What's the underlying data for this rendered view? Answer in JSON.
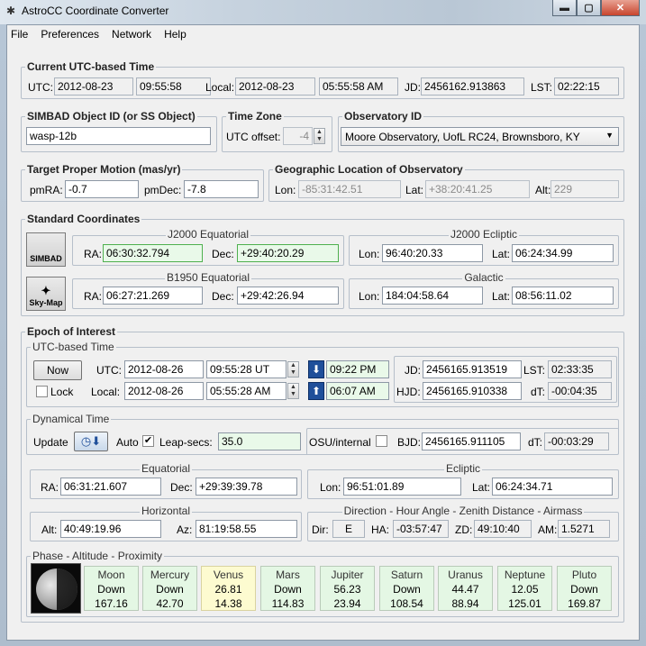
{
  "window": {
    "title": "AstroCC Coordinate Converter",
    "min": "▬",
    "max": "▢",
    "close": "✕"
  },
  "menu": [
    "File",
    "Preferences",
    "Network",
    "Help"
  ],
  "utc": {
    "title": "Current UTC-based Time",
    "utc_label": "UTC:",
    "date": "2012-08-23",
    "time": "09:55:58",
    "local_label": "Local:",
    "local_date": "2012-08-23",
    "local_time": "05:55:58 AM",
    "jd_label": "JD:",
    "jd": "2456162.913863",
    "lst_label": "LST:",
    "lst": "02:22:15"
  },
  "simbad": {
    "title": "SIMBAD Object ID (or SS Object)",
    "value": "wasp-12b"
  },
  "timezone": {
    "title": "Time Zone",
    "label": "UTC offset:",
    "value": "-4"
  },
  "observatory": {
    "title": "Observatory ID",
    "value": "Moore Observatory, UofL RC24, Brownsboro, KY"
  },
  "proper_motion": {
    "title": "Target Proper Motion (mas/yr)",
    "pmra_label": "pmRA:",
    "pmra": "-0.7",
    "pmdec_label": "pmDec:",
    "pmdec": "-7.8"
  },
  "geo": {
    "title": "Geographic Location of Observatory",
    "lon_label": "Lon:",
    "lon": "-85:31:42.51",
    "lat_label": "Lat:",
    "lat": "+38:20:41.25",
    "alt_label": "Alt:",
    "alt": "229"
  },
  "standard": {
    "title": "Standard Coordinates",
    "simbad_logo": "SIMBAD",
    "skymap_logo": "Sky-Map",
    "j2000eq": {
      "title": "J2000 Equatorial",
      "ra_label": "RA:",
      "ra": "06:30:32.794",
      "dec_label": "Dec:",
      "dec": "+29:40:20.29"
    },
    "j2000ec": {
      "title": "J2000 Ecliptic",
      "lon_label": "Lon:",
      "lon": "96:40:20.33",
      "lat_label": "Lat:",
      "lat": "06:24:34.99"
    },
    "b1950": {
      "title": "B1950 Equatorial",
      "ra_label": "RA:",
      "ra": "06:27:21.269",
      "dec_label": "Dec:",
      "dec": "+29:42:26.94"
    },
    "galactic": {
      "title": "Galactic",
      "lon_label": "Lon:",
      "lon": "184:04:58.64",
      "lat_label": "Lat:",
      "lat": "08:56:11.02"
    }
  },
  "epoch": {
    "title": "Epoch of Interest",
    "utc": {
      "title": "UTC-based Time",
      "now": "Now",
      "lock": "Lock",
      "utc_label": "UTC:",
      "date": "2012-08-26",
      "time": "09:55:28 UT",
      "local_label": "Local:",
      "local_date": "2012-08-26",
      "local_time": "05:55:28 AM",
      "sunset": "09:22 PM",
      "sunrise": "06:07 AM",
      "jd_label": "JD:",
      "jd": "2456165.913519",
      "lst_label": "LST:",
      "lst": "02:33:35",
      "hjd_label": "HJD:",
      "hjd": "2456165.910338",
      "dt_label": "dT:",
      "dt": "-00:04:35"
    },
    "dyn": {
      "title": "Dynamical Time",
      "update": "Update",
      "auto": "Auto",
      "auto_checked": "✔",
      "leap_label": "Leap-secs:",
      "leap": "35.0",
      "osu": "OSU/internal",
      "bjd_label": "BJD:",
      "bjd": "2456165.911105",
      "dt_label": "dT:",
      "dt": "-00:03:29"
    },
    "eq": {
      "title": "Equatorial",
      "ra_label": "RA:",
      "ra": "06:31:21.607",
      "dec_label": "Dec:",
      "dec": "+29:39:39.78"
    },
    "ec": {
      "title": "Ecliptic",
      "lon_label": "Lon:",
      "lon": "96:51:01.89",
      "lat_label": "Lat:",
      "lat": "06:24:34.71"
    },
    "hor": {
      "title": "Horizontal",
      "alt_label": "Alt:",
      "alt": "40:49:19.96",
      "az_label": "Az:",
      "az": "81:19:58.55"
    },
    "dir": {
      "title": "Direction - Hour Angle - Zenith Distance - Airmass",
      "dir_label": "Dir:",
      "dir": "E",
      "ha_label": "HA:",
      "ha": "-03:57:47",
      "zd_label": "ZD:",
      "zd": "49:10:40",
      "am_label": "AM:",
      "am": "1.5271"
    },
    "phase": {
      "title": "Phase - Altitude - Proximity",
      "planets": [
        {
          "name": "Moon",
          "a": "Down",
          "b": "167.16"
        },
        {
          "name": "Mercury",
          "a": "Down",
          "b": "42.70"
        },
        {
          "name": "Venus",
          "a": "26.81",
          "b": "14.38"
        },
        {
          "name": "Mars",
          "a": "Down",
          "b": "114.83"
        },
        {
          "name": "Jupiter",
          "a": "56.23",
          "b": "23.94"
        },
        {
          "name": "Saturn",
          "a": "Down",
          "b": "108.54"
        },
        {
          "name": "Uranus",
          "a": "44.47",
          "b": "88.94"
        },
        {
          "name": "Neptune",
          "a": "12.05",
          "b": "125.01"
        },
        {
          "name": "Pluto",
          "a": "Down",
          "b": "169.87"
        }
      ]
    }
  }
}
